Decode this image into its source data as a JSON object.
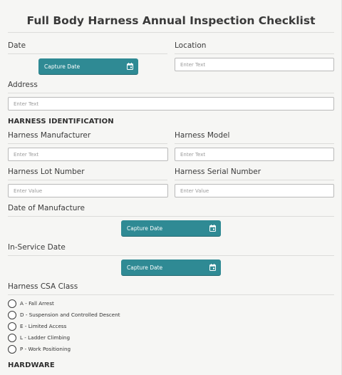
{
  "form": {
    "title": "Full Body Harness Annual Inspection Checklist"
  },
  "fields": {
    "date": {
      "label": "Date",
      "button": "Capture Date"
    },
    "location": {
      "label": "Location",
      "placeholder": "Enter Text"
    },
    "address": {
      "label": "Address",
      "placeholder": "Enter Text"
    }
  },
  "harness_identification": {
    "heading": "HARNESS IDENTIFICATION",
    "manufacturer": {
      "label": "Harness Manufacturer",
      "placeholder": "Enter Text"
    },
    "model": {
      "label": "Harness Model",
      "placeholder": "Enter Text"
    },
    "lot_number": {
      "label": "Harness Lot Number",
      "placeholder": "Enter Value"
    },
    "serial_number": {
      "label": "Harness Serial Number",
      "placeholder": "Enter Value"
    },
    "date_of_manufacture": {
      "label": "Date of Manufacture",
      "button": "Capture Date"
    },
    "in_service_date": {
      "label": "In-Service Date",
      "button": "Capture Date"
    },
    "csa_class": {
      "label": "Harness CSA Class",
      "options": [
        "A - Fall Arrest",
        "D - Suspension and Controlled Descent",
        "E - Limited Access",
        "L - Ladder Climbing",
        "P - Work Positioning"
      ]
    }
  },
  "hardware": {
    "heading": "HARDWARE"
  },
  "colors": {
    "accent": "#2f8a94",
    "background": "#f6f6f4"
  },
  "icons": {
    "date_button": "calendar-icon",
    "radio": "radio-unchecked-icon"
  }
}
